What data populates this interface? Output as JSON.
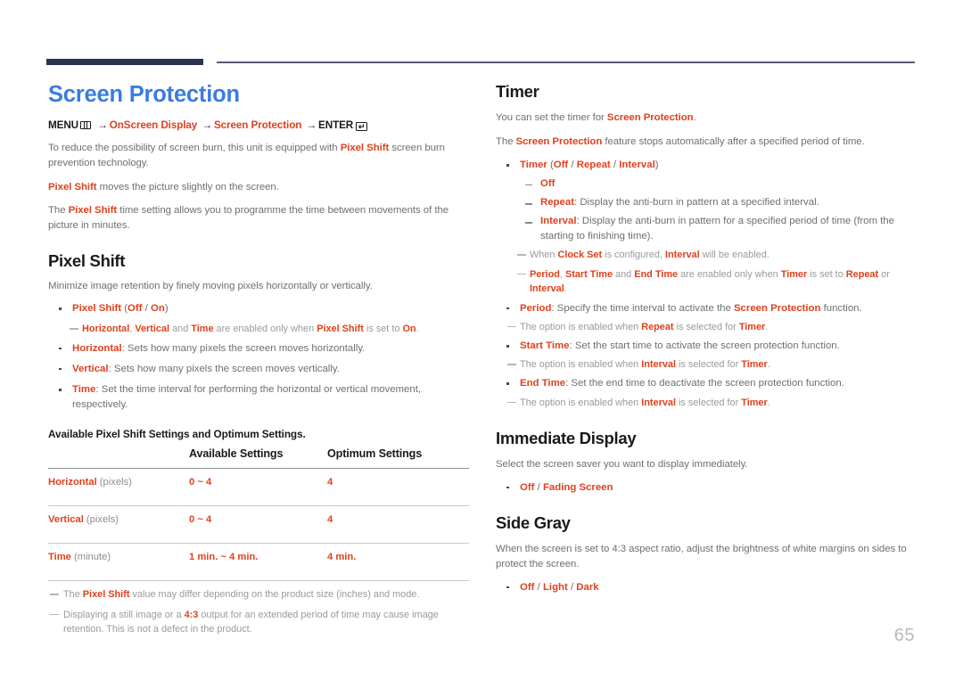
{
  "page": {
    "number": "65",
    "title": "Screen Protection",
    "accent_color": "#e0401c",
    "title_color": "#3a7ce0",
    "rule_color": "#2c3252"
  },
  "menu_path": {
    "menu_label": "MENU",
    "menu_icon": "menu-grid-icon",
    "arrow": "→",
    "step1": "OnScreen Display",
    "step2": "Screen Protection",
    "enter_label": "ENTER",
    "enter_icon": "enter-key-icon",
    "enter_glyph": "↵"
  },
  "intro": {
    "p1_a": "To reduce the possibility of screen burn, this unit is equipped with ",
    "p1_k": "Pixel Shift",
    "p1_b": " screen burn prevention technology.",
    "p2_k": "Pixel Shift",
    "p2_b": " moves the picture slightly on the screen.",
    "p3_a": "The ",
    "p3_k": "Pixel Shift",
    "p3_b": " time setting allows you to programme the time between movements of the picture in minutes."
  },
  "pixel_shift": {
    "heading": "Pixel Shift",
    "intro": "Minimize image retention by finely moving pixels horizontally or vertically.",
    "items": [
      {
        "key": "Pixel Shift",
        "paren_open": " (",
        "opt1": "Off",
        "sep": " / ",
        "opt2": "On",
        "paren_close": ")",
        "note": {
          "k1": "Horizontal",
          "t1": ", ",
          "k2": "Vertical",
          "t2": " and ",
          "k3": "Time",
          "t3": " are enabled only when ",
          "k4": "Pixel Shift",
          "t4": " is set to ",
          "k5": "On",
          "t5": "."
        }
      },
      {
        "key": "Horizontal",
        "text": ": Sets how many pixels the screen moves horizontally."
      },
      {
        "key": "Vertical",
        "text": ": Sets how many pixels the screen moves vertically."
      },
      {
        "key": "Time",
        "text": ": Set the time interval for performing the horizontal or vertical movement, respectively."
      }
    ],
    "table": {
      "caption": "Available Pixel Shift Settings and Optimum Settings.",
      "headers": [
        "",
        "Available Settings",
        "Optimum Settings"
      ],
      "rows": [
        {
          "label": "Horizontal",
          "unit": " (pixels)",
          "available": "0 ~ 4",
          "optimum": "4"
        },
        {
          "label": "Vertical",
          "unit": " (pixels)",
          "available": "0 ~ 4",
          "optimum": "4"
        },
        {
          "label": "Time",
          "unit": " (minute)",
          "available": "1 min. ~ 4 min.",
          "optimum": "4 min."
        }
      ]
    },
    "footnotes": [
      {
        "a": "The ",
        "k": "Pixel Shift",
        "b": " value may differ depending on the product size (inches) and mode."
      },
      {
        "a": "Displaying a still image or a ",
        "k": "4:3",
        "b": " output for an extended period of time may cause image retention. This is not a defect in the product."
      }
    ]
  },
  "timer": {
    "heading": "Timer",
    "p1_a": "You can set the timer for ",
    "p1_k": "Screen Protection",
    "p1_b": ".",
    "p2_a": "The ",
    "p2_k": "Screen Protection",
    "p2_b": " feature stops automatically after a specified period of time.",
    "main_item": {
      "key": "Timer",
      "paren_open": " (",
      "opt1": "Off",
      "sep1": " / ",
      "opt2": "Repeat",
      "sep2": " / ",
      "opt3": "Interval",
      "paren_close": ")"
    },
    "sub_items": [
      {
        "key": "Off",
        "text": ""
      },
      {
        "key": "Repeat",
        "text": ": Display the anti-burn in pattern at a specified interval."
      },
      {
        "key": "Interval",
        "text": ": Display the anti-burn in pattern for a specified period of time (from the starting to finishing time)."
      }
    ],
    "note_clock": {
      "a": "When ",
      "k1": "Clock Set",
      "b": " is configured, ",
      "k2": "Interval",
      "c": " will be enabled."
    },
    "note_period": {
      "k1": "Period",
      "t1": ", ",
      "k2": "Start Time",
      "t2": " and ",
      "k3": "End Time",
      "t3": " are enabled only when ",
      "k4": "Timer",
      "t4": " is set to ",
      "k5": "Repeat",
      "t5": " or ",
      "k6": "Interval",
      "t6": "."
    },
    "options": [
      {
        "key": "Period",
        "text_a": ": Specify the time interval to activate the ",
        "text_k": "Screen Protection",
        "text_b": " function.",
        "note": {
          "a": "The option is enabled when ",
          "k1": "Repeat",
          "b": " is selected for ",
          "k2": "Timer",
          "c": "."
        }
      },
      {
        "key": "Start Time",
        "text_a": ": Set the start time to activate the screen protection function.",
        "text_k": "",
        "text_b": "",
        "note": {
          "a": "The option is enabled when ",
          "k1": "Interval",
          "b": " is selected for ",
          "k2": "Timer",
          "c": "."
        }
      },
      {
        "key": "End Time",
        "text_a": ": Set the end time to deactivate the screen protection function.",
        "text_k": "",
        "text_b": "",
        "note": {
          "a": "The option is enabled when ",
          "k1": "Interval",
          "b": " is selected for ",
          "k2": "Timer",
          "c": "."
        }
      }
    ]
  },
  "immediate_display": {
    "heading": "Immediate Display",
    "intro": "Select the screen saver you want to display immediately.",
    "opt1": "Off",
    "sep": " / ",
    "opt2": "Fading Screen"
  },
  "side_gray": {
    "heading": "Side Gray",
    "intro": "When the screen is set to 4:3 aspect ratio, adjust the brightness of white margins on sides to protect the screen.",
    "opt1": "Off",
    "sep1": " / ",
    "opt2": "Light",
    "sep2": " / ",
    "opt3": "Dark"
  }
}
